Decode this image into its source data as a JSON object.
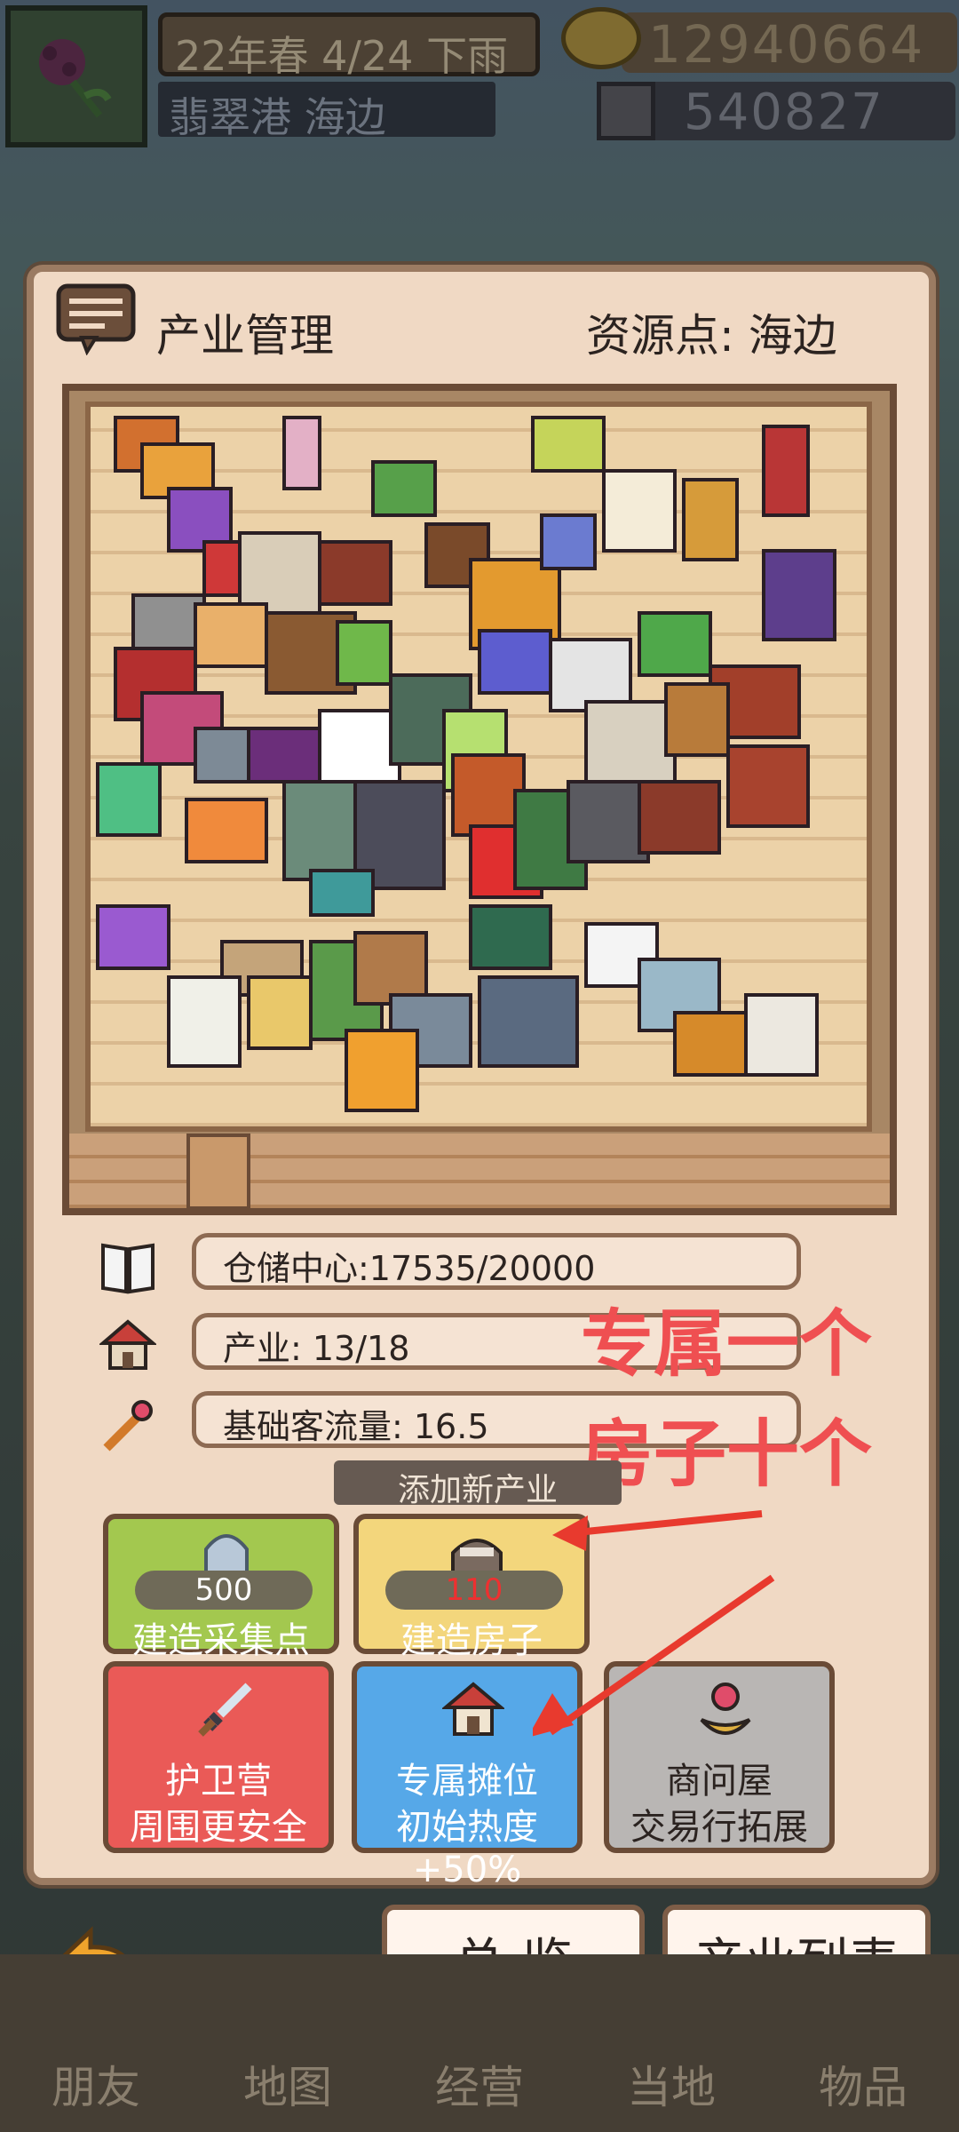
{
  "hud": {
    "date": "22年春 4/24 下雨",
    "location": "翡翠港 海边",
    "coins": "12940664",
    "gems": "540827"
  },
  "panel": {
    "title": "产业管理",
    "resource_point": "资源点: 海边"
  },
  "stats": {
    "storage": "仓储中心:17535/20000",
    "industry": "产业: 13/18",
    "traffic": "基础客流量: 16.5"
  },
  "add_new_label": "添加新产业",
  "buttons": {
    "gather": {
      "cost": "500",
      "label": "建造采集点",
      "color": "#a3c84f"
    },
    "house": {
      "cost": "110",
      "label": "建造房子",
      "color": "#f3d67c"
    },
    "guard": {
      "line1": "护卫营",
      "line2": "周围更安全",
      "color": "#ea5a57"
    },
    "stall": {
      "line1": "专属摊位",
      "line2": "初始热度+50%",
      "color": "#56a8e8"
    },
    "merchant": {
      "line1": "商问屋",
      "line2": "交易行拓展",
      "color": "#b9b6b4"
    }
  },
  "tabs": {
    "overview": "总 览",
    "list": "产业列表"
  },
  "nav": [
    "朋友",
    "地图",
    "经营",
    "当地",
    "物品"
  ],
  "annotation": {
    "line1": "专属一个",
    "line2": "房子十个",
    "color": "#ef4f51"
  }
}
